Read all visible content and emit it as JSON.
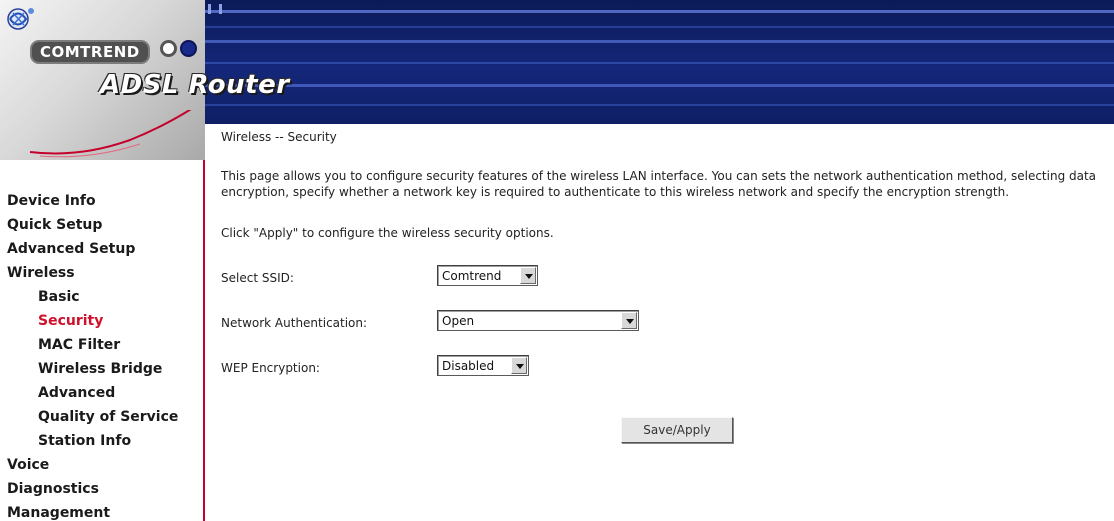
{
  "header": {
    "brand": "COMTREND",
    "product": "ADSL Router",
    "accent_color": "#c4002b",
    "icons": [
      "logo-swirl-icon"
    ]
  },
  "sidebar": {
    "items": [
      {
        "label": "Device Info",
        "level": 0,
        "active": false
      },
      {
        "label": "Quick Setup",
        "level": 0,
        "active": false
      },
      {
        "label": "Advanced Setup",
        "level": 0,
        "active": false
      },
      {
        "label": "Wireless",
        "level": 0,
        "active": false
      },
      {
        "label": "Basic",
        "level": 1,
        "active": false
      },
      {
        "label": "Security",
        "level": 1,
        "active": true
      },
      {
        "label": "MAC Filter",
        "level": 1,
        "active": false
      },
      {
        "label": "Wireless Bridge",
        "level": 1,
        "active": false
      },
      {
        "label": "Advanced",
        "level": 1,
        "active": false
      },
      {
        "label": "Quality of Service",
        "level": 1,
        "active": false
      },
      {
        "label": "Station Info",
        "level": 1,
        "active": false
      },
      {
        "label": "Voice",
        "level": 0,
        "active": false
      },
      {
        "label": "Diagnostics",
        "level": 0,
        "active": false
      },
      {
        "label": "Management",
        "level": 0,
        "active": false
      }
    ],
    "active_color": "#d0102b"
  },
  "main": {
    "title": "Wireless -- Security",
    "intro": "This page allows you to configure security features of the wireless LAN interface. You can sets the network authentication method, selecting data encryption, specify whether a network key is required to authenticate to this wireless network and specify the encryption strength.",
    "apply_hint": "Click \"Apply\" to configure the wireless security options.",
    "fields": {
      "ssid": {
        "label": "Select SSID:",
        "value": "Comtrend"
      },
      "auth": {
        "label": "Network Authentication:",
        "value": "Open"
      },
      "wep": {
        "label": "WEP Encryption:",
        "value": "Disabled"
      }
    },
    "save_label": "Save/Apply"
  }
}
